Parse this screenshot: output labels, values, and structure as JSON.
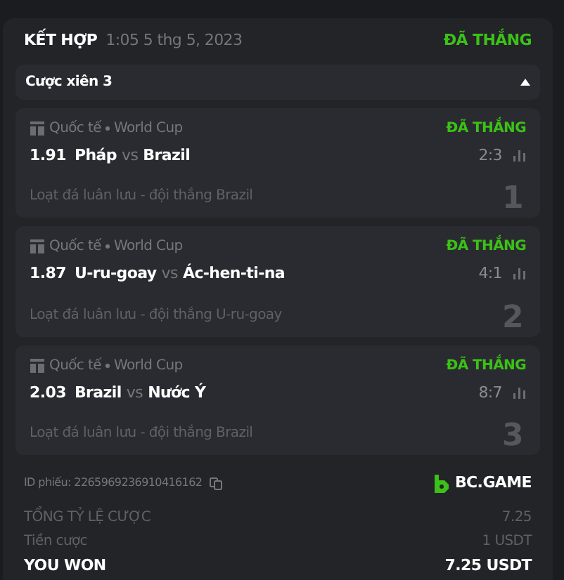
{
  "header": {
    "type": "KẾT HỢP",
    "time": "1:05 5 thg 5, 2023",
    "status": "ĐÃ THẮNG"
  },
  "parlay": {
    "label": "Cược xiên 3",
    "expanded": true
  },
  "legs": [
    {
      "league": "Quốc tế",
      "tournament": "World Cup",
      "status": "ĐÃ THẮNG",
      "odds": "1.91",
      "home": "Pháp",
      "vs": "vs",
      "away": "Brazil",
      "score": "2:3",
      "market": "Loạt đá luân lưu - đội thắng Brazil",
      "index": "1"
    },
    {
      "league": "Quốc tế",
      "tournament": "World Cup",
      "status": "ĐÃ THẮNG",
      "odds": "1.87",
      "home": "U-ru-goay",
      "vs": "vs",
      "away": "Ác-hen-ti-na",
      "score": "4:1",
      "market": "Loạt đá luân lưu - đội thắng U-ru-goay",
      "index": "2"
    },
    {
      "league": "Quốc tế",
      "tournament": "World Cup",
      "status": "ĐÃ THẮNG",
      "odds": "2.03",
      "home": "Brazil",
      "vs": "vs",
      "away": "Nước Ý",
      "score": "8:7",
      "market": "Loạt đá luân lưu - đội thắng Brazil",
      "index": "3"
    }
  ],
  "ticket": {
    "label": "ID phiếu:",
    "id": "2265969236910416162",
    "brand": "BC.GAME"
  },
  "summary": [
    {
      "kind": "muted",
      "label": "TỔNG TỶ LỆ CƯỢC",
      "value": "7.25"
    },
    {
      "kind": "muted",
      "label": "Tiền cược",
      "value": "1 USDT"
    },
    {
      "kind": "strong",
      "label": "YOU WON",
      "value": "7.25 USDT"
    }
  ]
}
